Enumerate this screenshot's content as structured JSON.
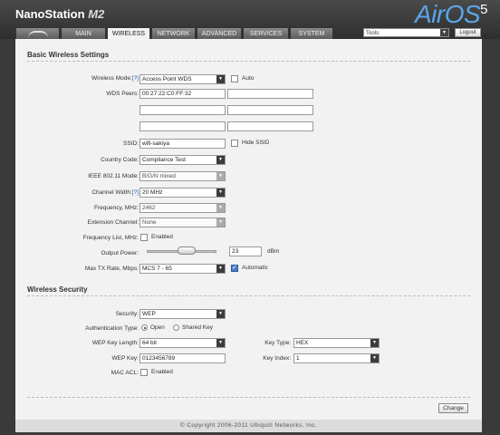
{
  "header": {
    "brand": "NanoStation",
    "model": "M2",
    "logo_text": "AirOS",
    "logo_sup": "5",
    "tabs": [
      "MAIN",
      "WIRELESS",
      "NETWORK",
      "ADVANCED",
      "SERVICES",
      "SYSTEM"
    ],
    "active_tab": "WIRELESS",
    "tools_value": "Tools:",
    "logout_label": "Logout"
  },
  "basic": {
    "title": "Basic Wireless Settings",
    "wireless_mode": {
      "label": "Wireless Mode:",
      "help": "[?]",
      "value": "Access Point WDS",
      "auto_label": "Auto"
    },
    "wds_peers": {
      "label": "WDS Peers:",
      "values": [
        "00:27:22:C0:FF:32",
        "",
        "",
        "",
        "",
        ""
      ]
    },
    "ssid": {
      "label": "SSID:",
      "value": "wifi-sakiya",
      "hide_label": "Hide SSID"
    },
    "country": {
      "label": "Country Code:",
      "value": "Compliance Test"
    },
    "ieee": {
      "label": "IEEE 802.11 Mode:",
      "value": "B/G/N mixed"
    },
    "channel_width": {
      "label": "Channel Width:",
      "help": "[?]",
      "value": "20 MHz"
    },
    "frequency": {
      "label": "Frequency, MHz:",
      "value": "2462"
    },
    "ext_channel": {
      "label": "Extension Channel:",
      "value": "None"
    },
    "freq_list": {
      "label": "Frequency List, MHz:",
      "enabled_label": "Enabled"
    },
    "output_power": {
      "label": "Output Power:",
      "value": "23",
      "unit": "dBm",
      "level": 0.6
    },
    "max_tx": {
      "label": "Max TX Rate, Mbps:",
      "value": "MCS 7 - 65",
      "auto_label": "Automatic"
    }
  },
  "security": {
    "title": "Wireless Security",
    "security": {
      "label": "Security:",
      "value": "WEP"
    },
    "auth_type": {
      "label": "Authentication Type:",
      "open_label": "Open",
      "shared_label": "Shared Key"
    },
    "key_length": {
      "label": "WEP Key Length:",
      "value": "64 bit"
    },
    "key_type": {
      "label": "Key Type:",
      "value": "HEX"
    },
    "wep_key": {
      "label": "WEP Key:",
      "value": "0123456789"
    },
    "key_index": {
      "label": "Key Index:",
      "value": "1"
    },
    "mac_acl": {
      "label": "MAC ACL:",
      "enabled_label": "Enabled"
    }
  },
  "change_label": "Change",
  "footer": "© Copyright 2006-2011 Ubiquiti Networks, Inc."
}
